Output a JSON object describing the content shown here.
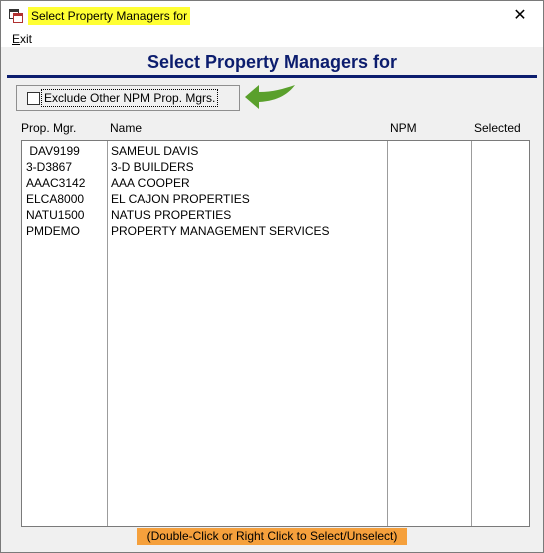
{
  "window": {
    "title": "Select Property Managers for",
    "close_glyph": "✕",
    "icon": "window-app-icon"
  },
  "menu": {
    "items": [
      {
        "label_prefix": "E",
        "label_rest": "xit"
      }
    ]
  },
  "heading": "Select Property Managers for",
  "exclude_checkbox": {
    "label": "Exclude Other NPM Prop. Mgrs.",
    "checked": false
  },
  "annotation": {
    "icon": "green-arrow-icon",
    "color": "#5aa02c"
  },
  "table": {
    "columns": [
      "Prop. Mgr.",
      "Name",
      "NPM",
      "Selected"
    ],
    "rows": [
      {
        "code": " DAV9199",
        "name": "SAMEUL DAVIS",
        "npm": "",
        "selected": ""
      },
      {
        "code": "3-D3867",
        "name": "3-D BUILDERS",
        "npm": "",
        "selected": ""
      },
      {
        "code": "AAAC3142",
        "name": "AAA COOPER",
        "npm": "",
        "selected": ""
      },
      {
        "code": "ELCA8000",
        "name": "EL CAJON PROPERTIES",
        "npm": "",
        "selected": ""
      },
      {
        "code": "NATU1500",
        "name": "NATUS PROPERTIES",
        "npm": "",
        "selected": ""
      },
      {
        "code": "PMDEMO",
        "name": "PROPERTY MANAGEMENT SERVICES",
        "npm": "",
        "selected": ""
      }
    ]
  },
  "hint": "(Double-Click or Right Click to Select/Unselect)",
  "colors": {
    "title_highlight": "#ffff33",
    "heading": "#0c1d6e",
    "hint_bg": "#f5a03c"
  }
}
